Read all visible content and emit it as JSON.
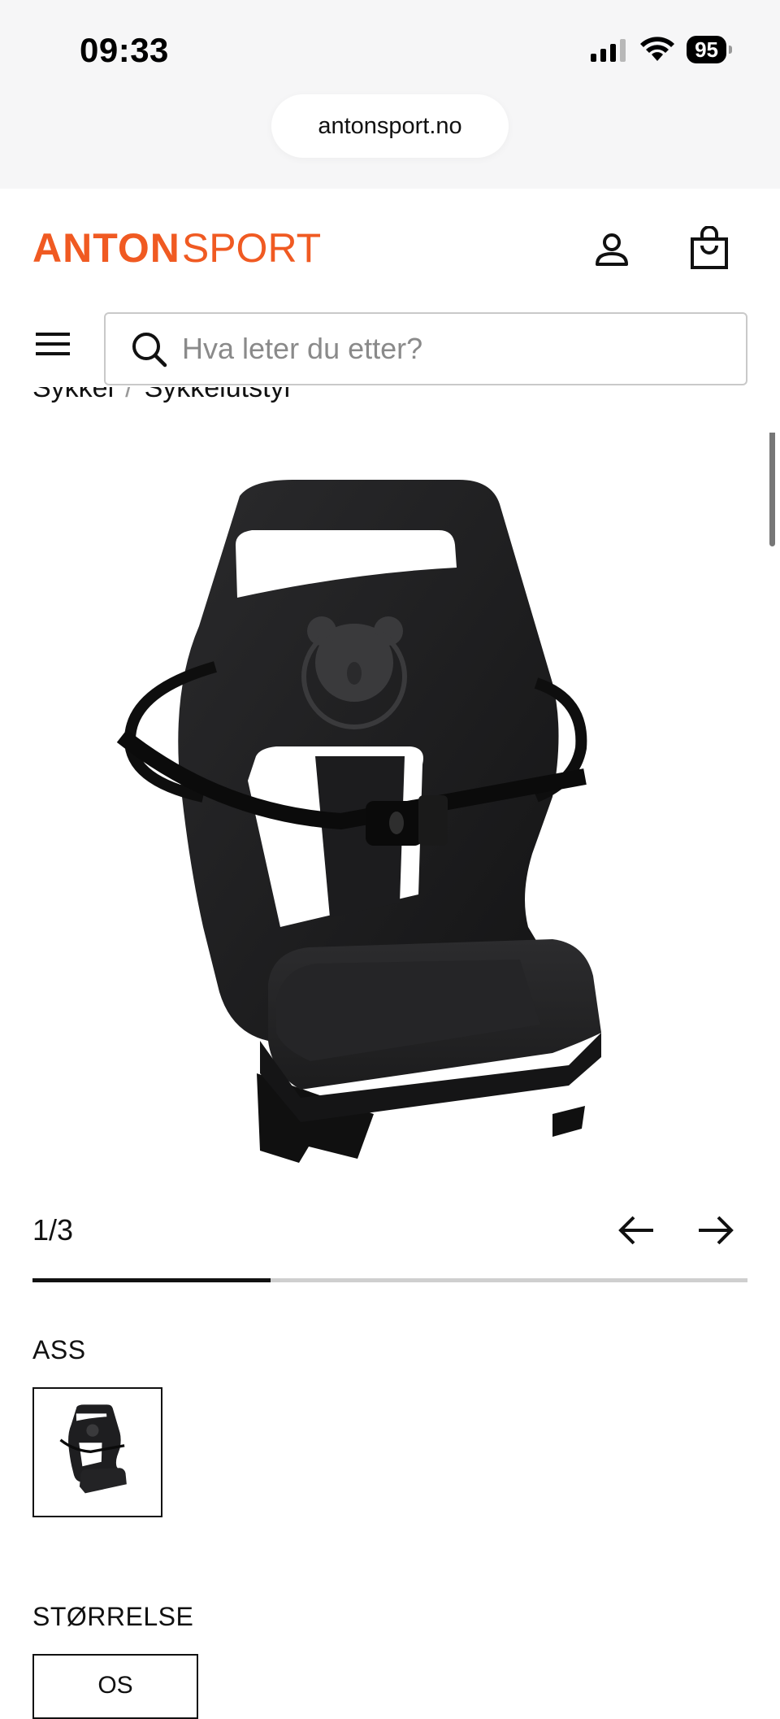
{
  "status_bar": {
    "time": "09:33",
    "battery": "95",
    "icons": [
      "signal-icon",
      "wifi-icon",
      "battery-icon"
    ]
  },
  "browser": {
    "url": "antonsport.no"
  },
  "header": {
    "logo_bold": "ANTON",
    "logo_light": "SPORT",
    "brand_color": "#f05a22",
    "icons": [
      "account-icon",
      "shopping-bag-icon",
      "hamburger-menu-icon"
    ]
  },
  "search": {
    "placeholder": "Hva leter du etter?"
  },
  "breadcrumb": {
    "items": [
      "Sykkel",
      "Sykkelutstyr"
    ],
    "separator": "/"
  },
  "gallery": {
    "counter": "1/3",
    "current": 1,
    "total": 3,
    "progress_fraction": 0.333
  },
  "variant": {
    "label": "ASS"
  },
  "size": {
    "label": "STØRRELSE",
    "options": [
      "OS"
    ]
  }
}
